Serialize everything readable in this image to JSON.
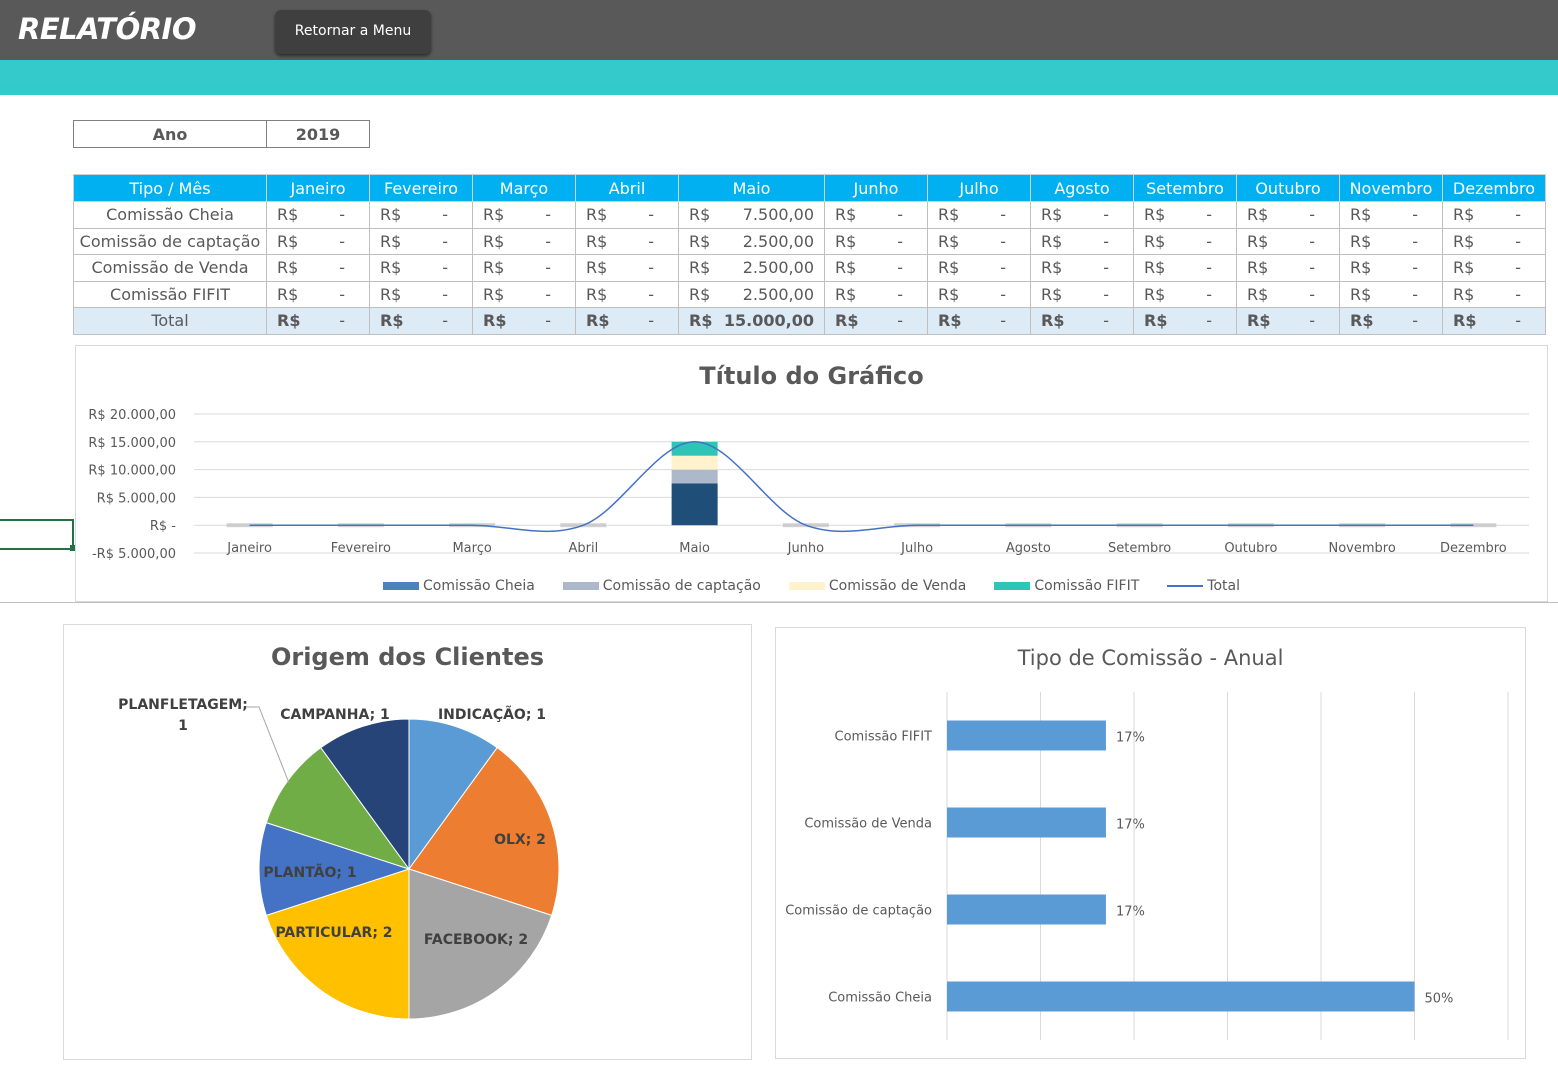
{
  "header": {
    "title": "RELATÓRIO",
    "menu_button": "Retornar a Menu",
    "colors": {
      "bar": "#595959",
      "accent": "#34c9cb"
    }
  },
  "year_selector": {
    "label": "Ano",
    "value": "2019"
  },
  "table": {
    "corner": "Tipo / Mês",
    "months": [
      "Janeiro",
      "Fevereiro",
      "Março",
      "Abril",
      "Maio",
      "Junho",
      "Julho",
      "Agosto",
      "Setembro",
      "Outubro",
      "Novembro",
      "Dezembro"
    ],
    "currency": "R$",
    "rows": [
      {
        "label": "Comissão Cheia",
        "values": [
          "-",
          "-",
          "-",
          "-",
          "7.500,00",
          "-",
          "-",
          "-",
          "-",
          "-",
          "-",
          "-"
        ]
      },
      {
        "label": "Comissão de captação",
        "values": [
          "-",
          "-",
          "-",
          "-",
          "2.500,00",
          "-",
          "-",
          "-",
          "-",
          "-",
          "-",
          "-"
        ]
      },
      {
        "label": "Comissão de Venda",
        "values": [
          "-",
          "-",
          "-",
          "-",
          "2.500,00",
          "-",
          "-",
          "-",
          "-",
          "-",
          "-",
          "-"
        ]
      },
      {
        "label": "Comissão FIFIT",
        "values": [
          "-",
          "-",
          "-",
          "-",
          "2.500,00",
          "-",
          "-",
          "-",
          "-",
          "-",
          "-",
          "-"
        ]
      }
    ],
    "total": {
      "label": "Total",
      "values": [
        "-",
        "-",
        "-",
        "-",
        "15.000,00",
        "-",
        "-",
        "-",
        "-",
        "-",
        "-",
        "-"
      ]
    }
  },
  "chart_data": [
    {
      "type": "bar",
      "title": "Título do Gráfico",
      "stacked": true,
      "categories": [
        "Janeiro",
        "Fevereiro",
        "Março",
        "Abril",
        "Maio",
        "Junho",
        "Julho",
        "Agosto",
        "Setembro",
        "Outubro",
        "Novembro",
        "Dezembro"
      ],
      "series": [
        {
          "name": "Comissão Cheia",
          "kind": "bar",
          "color": "#1f4e79",
          "values": [
            0,
            0,
            0,
            0,
            7500,
            0,
            0,
            0,
            0,
            0,
            0,
            0
          ]
        },
        {
          "name": "Comissão de captação",
          "kind": "bar",
          "color": "#adb9ca",
          "values": [
            0,
            0,
            0,
            0,
            2500,
            0,
            0,
            0,
            0,
            0,
            0,
            0
          ]
        },
        {
          "name": "Comissão de Venda",
          "kind": "bar",
          "color": "#fff2cc",
          "values": [
            0,
            0,
            0,
            0,
            2500,
            0,
            0,
            0,
            0,
            0,
            0,
            0
          ]
        },
        {
          "name": "Comissão FIFIT",
          "kind": "bar",
          "color": "#2ec4b6",
          "values": [
            0,
            0,
            0,
            0,
            2500,
            0,
            0,
            0,
            0,
            0,
            0,
            0
          ]
        },
        {
          "name": "Total",
          "kind": "line",
          "color": "#4472c4",
          "values": [
            0,
            0,
            0,
            0,
            15000,
            0,
            0,
            0,
            0,
            0,
            0,
            0
          ]
        }
      ],
      "legend_swatches": [
        "#4f81bd",
        "#adb9ca",
        "#fff2cc",
        "#2ec4b6"
      ],
      "ylim": [
        -5000,
        20000
      ],
      "yticks": [
        -5000,
        0,
        5000,
        10000,
        15000,
        20000
      ],
      "ytick_labels": [
        "-R$ 5.000,00",
        "R$ -",
        "R$ 5.000,00",
        "R$ 10.000,00",
        "R$ 15.000,00",
        "R$ 20.000,00"
      ],
      "grid": true,
      "legend": "bottom"
    },
    {
      "type": "pie",
      "title": "Origem dos Clientes",
      "slices": [
        {
          "label": "INDICAÇÃO; 1",
          "value": 1,
          "color": "#5b9bd5"
        },
        {
          "label": "OLX; 2",
          "value": 2,
          "color": "#ed7d31"
        },
        {
          "label": "FACEBOOK; 2",
          "value": 2,
          "color": "#a5a5a5"
        },
        {
          "label": "PARTICULAR; 2",
          "value": 2,
          "color": "#ffc000"
        },
        {
          "label": "PLANTÃO; 1",
          "value": 1,
          "color": "#4472c4"
        },
        {
          "label": "PLANFLETAGEM; 1",
          "value": 1,
          "color": "#70ad47"
        },
        {
          "label": "CAMPANHA; 1",
          "value": 1,
          "color": "#264478"
        }
      ]
    },
    {
      "type": "bar",
      "orientation": "horizontal",
      "title": "Tipo de Comissão - Anual",
      "categories": [
        "Comissão FIFIT",
        "Comissão de Venda",
        "Comissão de captação",
        "Comissão Cheia"
      ],
      "values": [
        17,
        17,
        17,
        50
      ],
      "value_labels": [
        "17%",
        "17%",
        "17%",
        "50%"
      ],
      "color": "#5b9bd5",
      "xlim": [
        0,
        60
      ],
      "grid": true
    }
  ]
}
